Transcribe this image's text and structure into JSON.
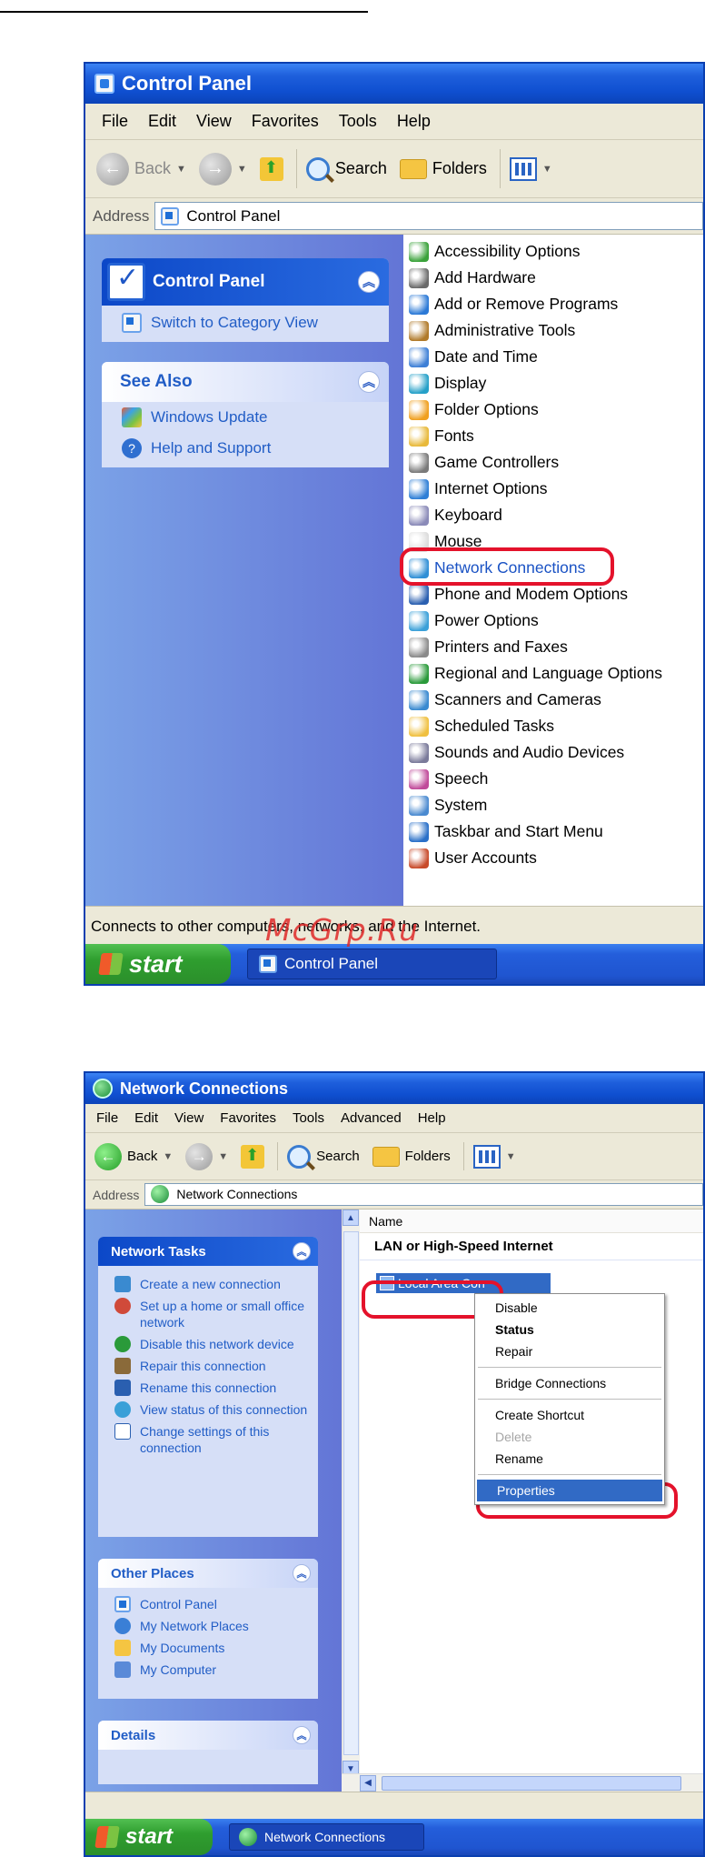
{
  "watermark": "McGrp.Ru",
  "window1": {
    "title": "Control Panel",
    "menu": [
      "File",
      "Edit",
      "View",
      "Favorites",
      "Tools",
      "Help"
    ],
    "toolbar": {
      "back": "Back",
      "search": "Search",
      "folders": "Folders"
    },
    "address": {
      "label": "Address",
      "value": "Control Panel"
    },
    "panel_cp": {
      "title": "Control Panel",
      "switch": "Switch to Category View"
    },
    "see_also": {
      "title": "See Also",
      "items": [
        "Windows Update",
        "Help and Support"
      ]
    },
    "items": [
      "Accessibility Options",
      "Add Hardware",
      "Add or Remove Programs",
      "Administrative Tools",
      "Date and Time",
      "Display",
      "Folder Options",
      "Fonts",
      "Game Controllers",
      "Internet Options",
      "Keyboard",
      "Mouse",
      "Network Connections",
      "Phone and Modem Options",
      "Power Options",
      "Printers and Faxes",
      "Regional and Language Options",
      "Scanners and Cameras",
      "Scheduled Tasks",
      "Sounds and Audio Devices",
      "Speech",
      "System",
      "Taskbar and Start Menu",
      "User Accounts"
    ],
    "highlighted_item": "Network Connections",
    "status": "Connects to other computers, networks, and the Internet.",
    "taskbar": {
      "start": "start",
      "task": "Control Panel"
    }
  },
  "window2": {
    "title": "Network Connections",
    "menu": [
      "File",
      "Edit",
      "View",
      "Favorites",
      "Tools",
      "Advanced",
      "Help"
    ],
    "toolbar": {
      "back": "Back",
      "search": "Search",
      "folders": "Folders"
    },
    "address": {
      "label": "Address",
      "value": "Network Connections"
    },
    "network_tasks": {
      "title": "Network Tasks",
      "items": [
        "Create a new connection",
        "Set up a home or small office network",
        "Disable this network device",
        "Repair this connection",
        "Rename this connection",
        "View status of this connection",
        "Change settings of this connection"
      ]
    },
    "other_places": {
      "title": "Other Places",
      "items": [
        "Control Panel",
        "My Network Places",
        "My Documents",
        "My Computer"
      ]
    },
    "details": {
      "title": "Details"
    },
    "column_header": "Name",
    "group_header": "LAN or High-Speed Internet",
    "lan_item": "Local Area Con",
    "context_menu": {
      "disable": "Disable",
      "status": "Status",
      "repair": "Repair",
      "bridge": "Bridge Connections",
      "shortcut": "Create Shortcut",
      "delete": "Delete",
      "rename": "Rename",
      "properties": "Properties"
    },
    "taskbar": {
      "start": "start",
      "task": "Network Connections"
    }
  },
  "icon_colors": [
    "#3aa23a",
    "#6a6a6a",
    "#2b79d6",
    "#b07a2a",
    "#3d7fd6",
    "#25a0c8",
    "#f0a020",
    "#e8b93a",
    "#7a7a7a",
    "#2f7fd6",
    "#8a8ab8",
    "#dcdcdc",
    "#2f8fd6",
    "#2a5fb0",
    "#3aa0d8",
    "#8a8a8a",
    "#2a9a3a",
    "#3a8ad0",
    "#f0c040",
    "#7a7a9a",
    "#c04a9a",
    "#4a8ad0",
    "#2a70c8",
    "#c84a2a"
  ],
  "accent_colors": {
    "titlebar": "#0f4fd0",
    "selection": "#316ac5",
    "highlight_ring": "#e4122b",
    "link": "#215dc6"
  }
}
